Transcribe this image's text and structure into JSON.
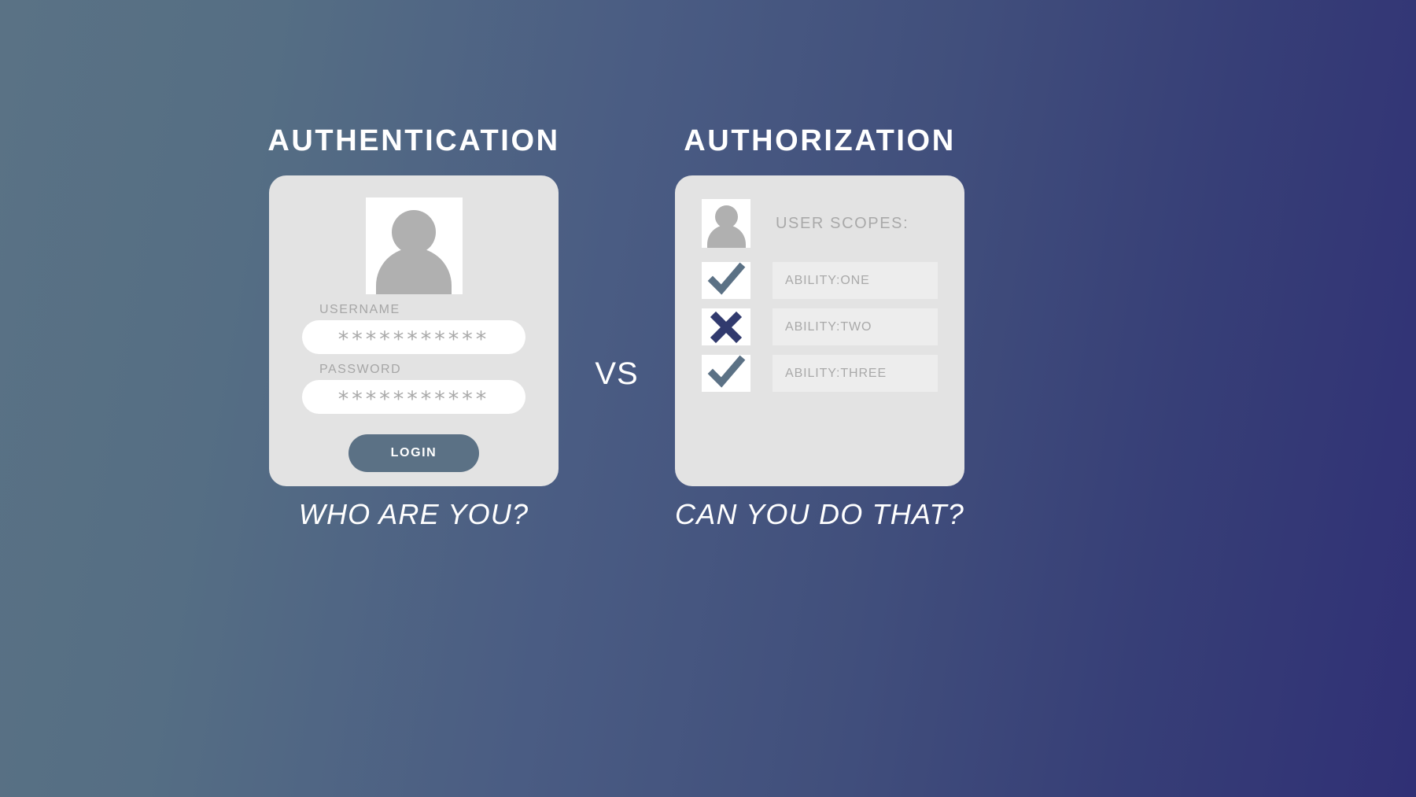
{
  "background": {
    "gradient_from": "#5a7285",
    "gradient_to": "#303075"
  },
  "divider": {
    "label": "VS"
  },
  "left": {
    "title": "AUTHENTICATION",
    "caption": "WHO ARE YOU?",
    "avatar_icon": "user-avatar-icon",
    "fields": [
      {
        "label": "USERNAME",
        "value": "***********",
        "placeholder": "Username"
      },
      {
        "label": "PASSWORD",
        "value": "***********",
        "placeholder": "Password"
      }
    ],
    "login_label": "LOGIN",
    "login_color": "#5b7185"
  },
  "right": {
    "title": "AUTHORIZATION",
    "caption": "CAN YOU DO THAT?",
    "avatar_icon": "user-avatar-icon",
    "scopes_title": "USER SCOPES:",
    "check_color": "#5b7185",
    "cross_color": "#313a6e",
    "scopes": [
      {
        "mark": "check-icon",
        "label": "ABILITY:ONE",
        "granted": true
      },
      {
        "mark": "cross-icon",
        "label": "ABILITY:TWO",
        "granted": false
      },
      {
        "mark": "check-icon",
        "label": "ABILITY:THREE",
        "granted": true
      }
    ]
  }
}
